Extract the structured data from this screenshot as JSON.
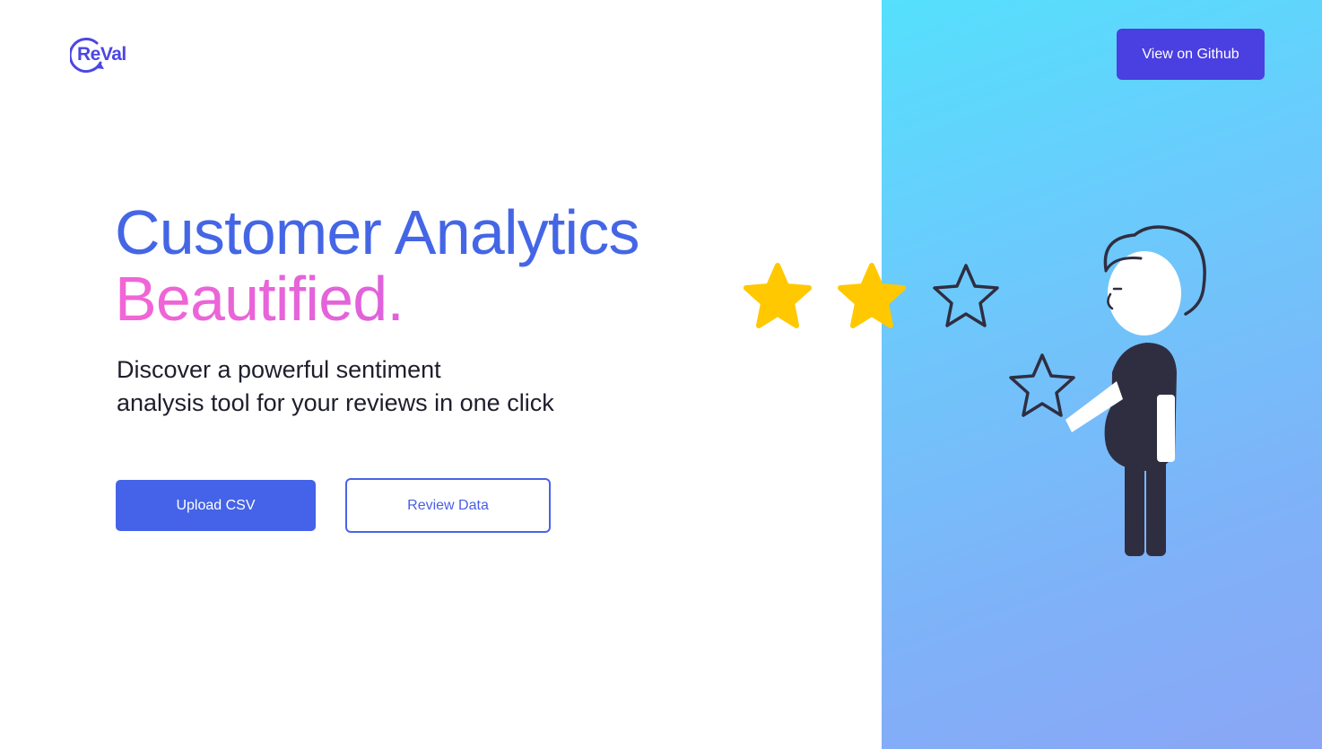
{
  "brand": {
    "logo_text": "ReVal",
    "logo_color": "#4b46e4"
  },
  "header": {
    "github_label": "View on Github"
  },
  "hero": {
    "title_line1": "Customer Analytics",
    "title_line2": "Beautified.",
    "subtitle_line1": "Discover a powerful sentiment",
    "subtitle_line2": "analysis tool for your reviews in one click",
    "primary_label": "Upload CSV",
    "secondary_label": "Review Data"
  },
  "illustration": {
    "rating_stars_filled": 2,
    "rating_stars_total": 3,
    "icons": [
      "star-filled-icon",
      "star-filled-icon",
      "star-outline-icon",
      "star-outline-icon",
      "person-illustration"
    ]
  },
  "colors": {
    "accent_blue": "#4563e8",
    "github_button": "#4a3fe0",
    "title_blue": "#4466e6",
    "title_pink": "#f265d6",
    "star_yellow": "#ffc800",
    "panel_gradient_start": "#55e0fd",
    "panel_gradient_end": "#8aa6f6"
  }
}
